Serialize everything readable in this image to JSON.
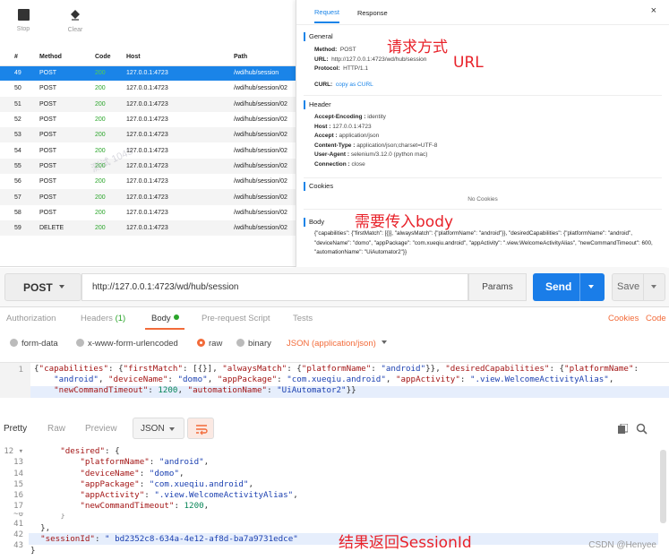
{
  "sniffer": {
    "toolbar": {
      "stop_label": "Stop",
      "clear_label": "Clear"
    },
    "columns": [
      "#",
      "Method",
      "Code",
      "Host",
      "Path"
    ],
    "rows": [
      {
        "num": "49",
        "method": "POST",
        "code": "200",
        "host": "127.0.0.1:4723",
        "path": "/wd/hub/session",
        "selected": true
      },
      {
        "num": "50",
        "method": "POST",
        "code": "200",
        "host": "127.0.0.1:4723",
        "path": "/wd/hub/session/02"
      },
      {
        "num": "51",
        "method": "POST",
        "code": "200",
        "host": "127.0.0.1:4723",
        "path": "/wd/hub/session/02"
      },
      {
        "num": "52",
        "method": "POST",
        "code": "200",
        "host": "127.0.0.1:4723",
        "path": "/wd/hub/session/02"
      },
      {
        "num": "53",
        "method": "POST",
        "code": "200",
        "host": "127.0.0.1:4723",
        "path": "/wd/hub/session/02"
      },
      {
        "num": "54",
        "method": "POST",
        "code": "200",
        "host": "127.0.0.1:4723",
        "path": "/wd/hub/session/02"
      },
      {
        "num": "55",
        "method": "POST",
        "code": "200",
        "host": "127.0.0.1:4723",
        "path": "/wd/hub/session/02"
      },
      {
        "num": "56",
        "method": "POST",
        "code": "200",
        "host": "127.0.0.1:4723",
        "path": "/wd/hub/session/02"
      },
      {
        "num": "57",
        "method": "POST",
        "code": "200",
        "host": "127.0.0.1:4723",
        "path": "/wd/hub/session/02"
      },
      {
        "num": "58",
        "method": "POST",
        "code": "200",
        "host": "127.0.0.1:4723",
        "path": "/wd/hub/session/02"
      },
      {
        "num": "59",
        "method": "DELETE",
        "code": "200",
        "host": "127.0.0.1:4723",
        "path": "/wd/hub/session/02"
      }
    ],
    "watermark": "测试 1043",
    "detail": {
      "tabs": [
        "Request",
        "Response"
      ],
      "close_glyph": "×",
      "general": {
        "title": "General",
        "method_k": "Method:",
        "method_v": "POST",
        "url_k": "URL:",
        "url_v": "http://127.0.0.1:4723/wd/hub/session",
        "protocol_k": "Protocol:",
        "protocol_v": "HTTP/1.1",
        "curl_k": "CURL:",
        "curl_v": "copy as CURL"
      },
      "header": {
        "title": "Header",
        "items": [
          {
            "k": "Accept-Encoding :",
            "v": "identity"
          },
          {
            "k": "Host :",
            "v": "127.0.0.1:4723"
          },
          {
            "k": "Accept :",
            "v": "application/json"
          },
          {
            "k": "Content-Type :",
            "v": "application/json;charset=UTF-8"
          },
          {
            "k": "User-Agent :",
            "v": "selenium/3.12.0 (python mac)"
          },
          {
            "k": "Connection :",
            "v": "close"
          }
        ]
      },
      "cookies": {
        "title": "Cookies",
        "empty": "No Cookies"
      },
      "body": {
        "title": "Body",
        "json": "{\"capabilities\": {\"firstMatch\": [{}], \"alwaysMatch\": {\"platformName\": \"android\"}}, \"desiredCapabilities\": {\"platformName\": \"android\", \"deviceName\": \"domo\", \"appPackage\": \"com.xueqiu.android\", \"appActivity\": \".view.WelcomeActivityAlias\", \"newCommandTimeout\": 600, \"automationName\": \"UiAutomator2\"}}"
      }
    },
    "annotations": {
      "method": "请求方式",
      "url": "URL",
      "body": "需要传入body"
    }
  },
  "request": {
    "method": "POST",
    "url": "http://127.0.0.1:4723/wd/hub/session",
    "params_label": "Params",
    "send_label": "Send",
    "save_label": "Save",
    "tabs": {
      "authorization": "Authorization",
      "headers": "Headers",
      "headers_count": "(1)",
      "body": "Body",
      "prerequest": "Pre-request Script",
      "tests": "Tests",
      "cookies": "Cookies",
      "code": "Code"
    },
    "body_modes": [
      "form-data",
      "x-www-form-urlencoded",
      "raw",
      "binary"
    ],
    "body_type": "JSON (application/json)",
    "editor_line": "1"
  },
  "response": {
    "views": [
      "Pretty",
      "Raw",
      "Preview"
    ],
    "format": "JSON",
    "gutter": [
      "12 ▾",
      "13",
      "14",
      "15",
      "16",
      "17",
      "~0",
      "41",
      "42",
      "43"
    ],
    "session_id": " bd2352c8-634a-4e12-af8d-ba7a9731edce",
    "annotation": "结果返回SessionId"
  },
  "footer": {
    "credit": "CSDN @Henyee"
  },
  "colors": {
    "accent_blue": "#1a84e8",
    "postman_orange": "#f26b3a",
    "send_blue": "#1a7de8",
    "ok_green": "#2aa52a",
    "annotation_red": "#e8222a"
  }
}
